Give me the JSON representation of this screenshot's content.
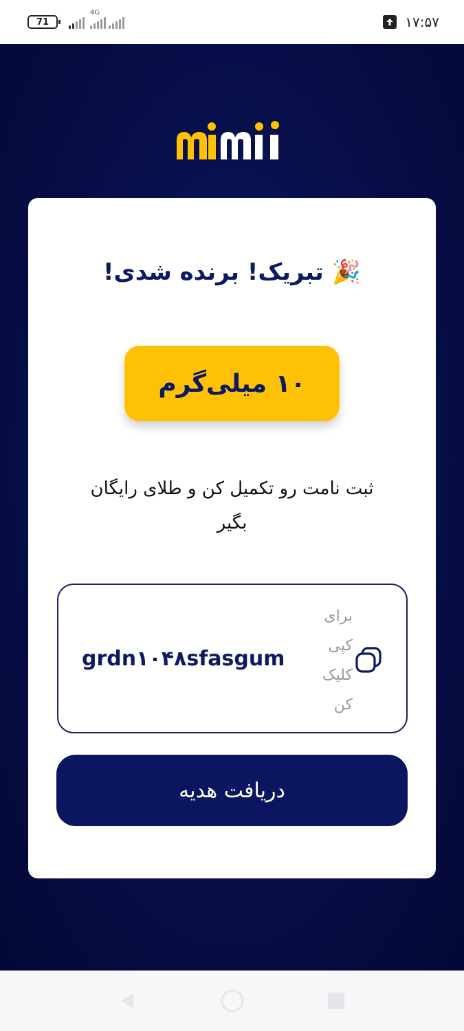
{
  "status_bar": {
    "battery": "71",
    "network": "4G",
    "time": "۱۷:۵۷"
  },
  "brand": {
    "logo_text": "miili",
    "colors": {
      "yellow": "#ffc106",
      "navy": "#0c1a63",
      "background": "#08104d"
    }
  },
  "card": {
    "title": "تبریک! برنده شدی!",
    "title_emoji": "🎉",
    "amount": "۱۰ میلی‌گرم",
    "subtitle_line1": "ثبت نامت رو تکمیل کن و طلای رایگان",
    "subtitle_line2": "بگیر",
    "code": "grdn۱۰۴۸sfasgum",
    "copy_hint": [
      "برای",
      "کپی",
      "کلیک",
      "کن"
    ],
    "copy_icon": "copy-icon",
    "cta_label": "دریافت هدیه"
  },
  "nav_bar": {
    "icons": [
      "back-icon",
      "home-icon",
      "recent-apps-icon"
    ]
  }
}
